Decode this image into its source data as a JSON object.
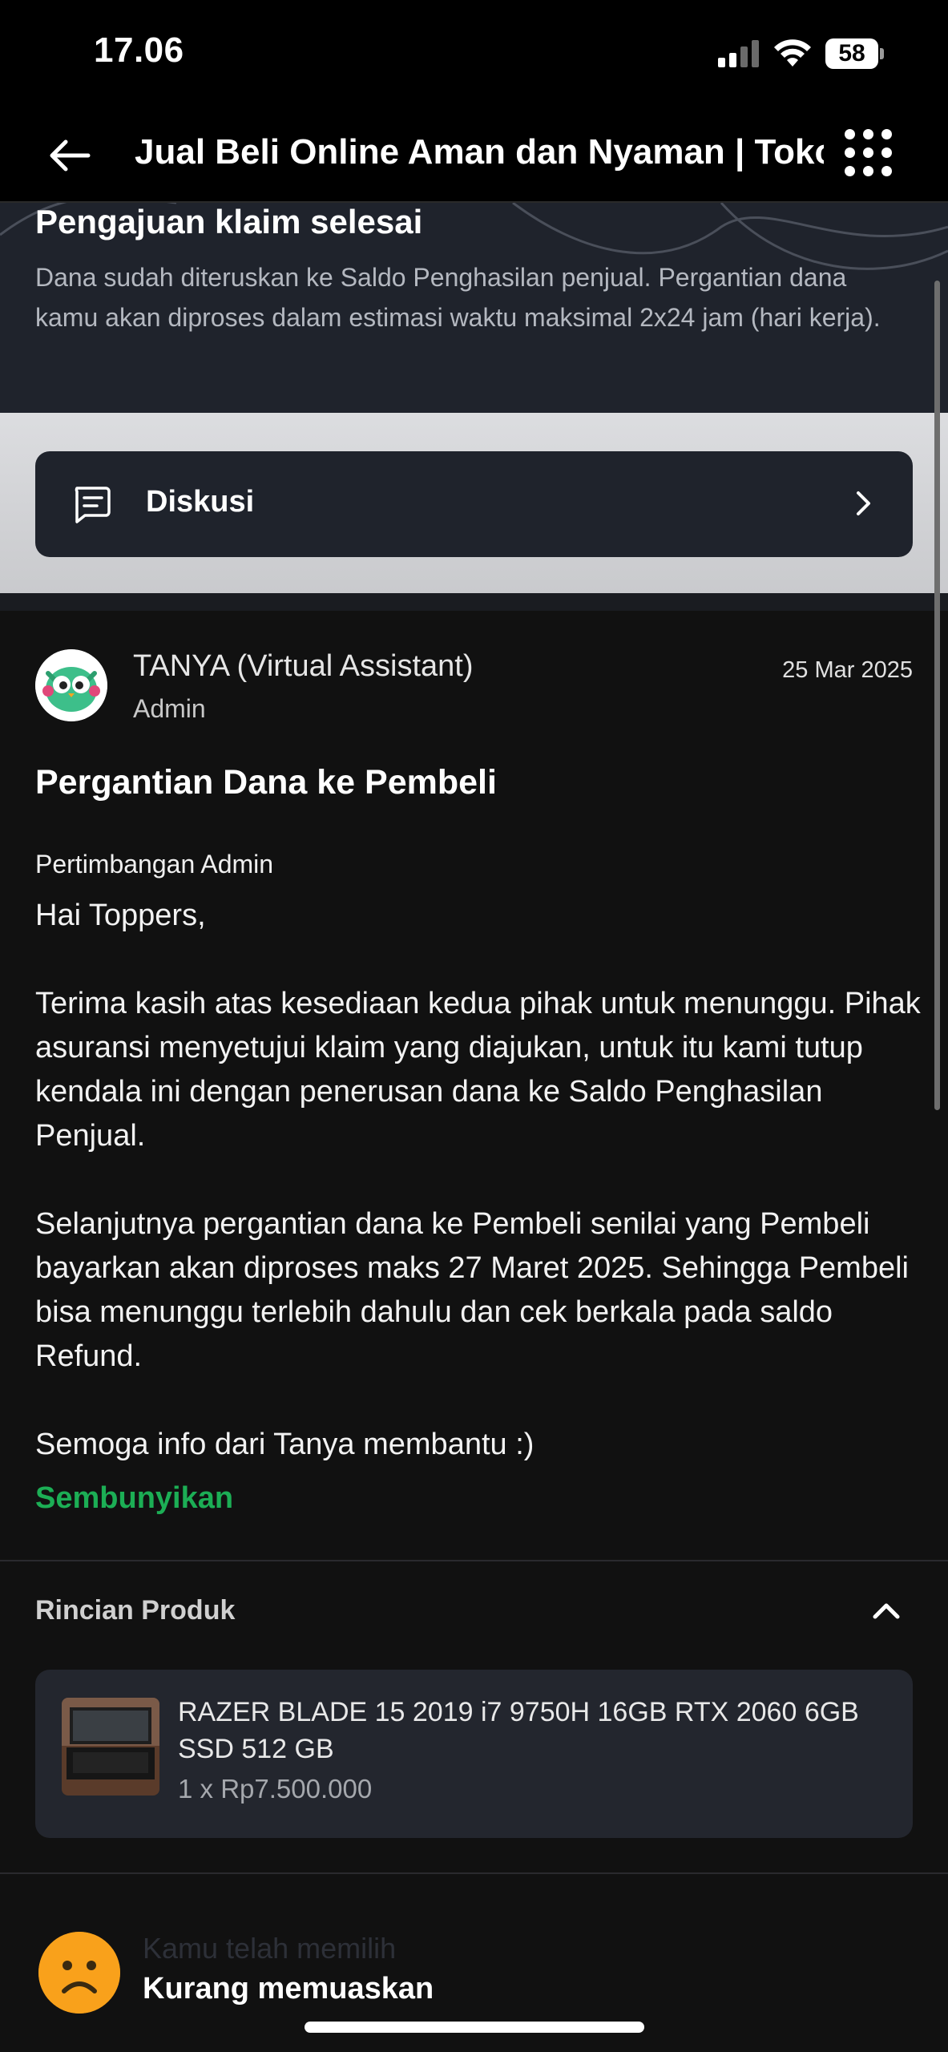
{
  "status_bar": {
    "time": "17.06",
    "battery": "58"
  },
  "header": {
    "title": "Jual Beli Online Aman dan Nyaman | Tokopedia"
  },
  "claim": {
    "title": "Pengajuan klaim selesai",
    "description": "Dana sudah diteruskan ke Saldo Penghasilan penjual. Pergantian dana kamu akan diproses dalam estimasi waktu maksimal 2x24 jam (hari kerja)."
  },
  "discussion": {
    "label": "Diskusi"
  },
  "message": {
    "sender": "TANYA (Virtual Assistant)",
    "role": "Admin",
    "date": "25 Mar 2025",
    "title": "Pergantian Dana ke Pembeli",
    "subtitle": "Pertimbangan Admin",
    "paragraphs": [
      "Hai Toppers,",
      "Terima kasih atas kesediaan kedua pihak untuk menunggu. Pihak asuransi menyetujui klaim yang diajukan, untuk itu kami tutup kendala ini dengan penerusan dana ke Saldo Penghasilan Penjual.",
      "Selanjutnya pergantian dana ke Pembeli senilai yang Pembeli bayarkan akan diproses maks 27 Maret 2025. Sehingga Pembeli bisa menunggu terlebih dahulu dan cek berkala pada saldo Refund.",
      "Semoga info dari Tanya membantu :)"
    ],
    "hide_label": "Sembunyikan"
  },
  "product": {
    "section_title": "Rincian Produk",
    "name": "RAZER BLADE 15 2019 i7 9750H 16GB RTX 2060 6GB SSD 512 GB",
    "price": "1 x Rp7.500.000"
  },
  "rating": {
    "caption": "Kamu telah memilih",
    "value": "Kurang memuaskan"
  },
  "colors": {
    "accent_green": "#1cae55",
    "card_bg": "#23262e",
    "rating_face": "#f9a11b"
  },
  "icons": [
    "back-arrow-icon",
    "menu-grid-icon",
    "chat-bubble-icon",
    "chevron-right-icon",
    "chevron-up-icon",
    "sad-face-icon"
  ]
}
